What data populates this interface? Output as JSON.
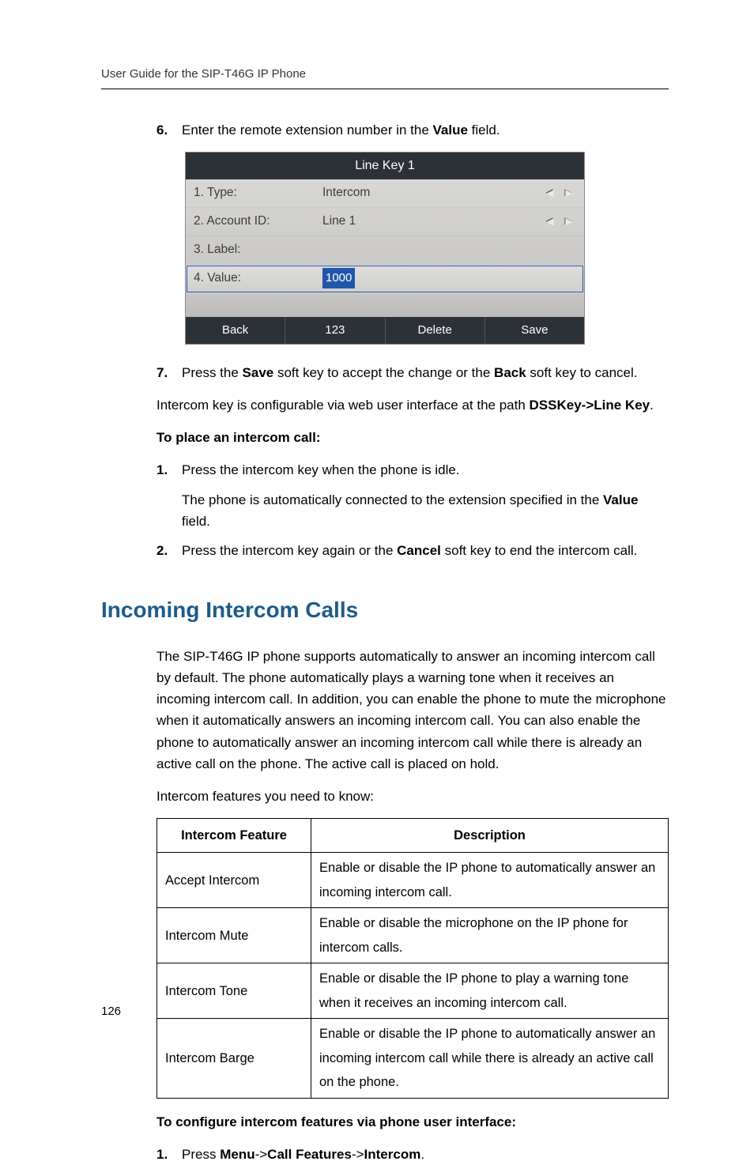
{
  "running_head": "User Guide for the SIP-T46G IP Phone",
  "page_number": "126",
  "steps_a": {
    "s6": {
      "n": "6.",
      "pre": "Enter the remote extension number in the ",
      "bold": "Value",
      "post": " field."
    },
    "s7": {
      "n": "7.",
      "pre": "Press the ",
      "b1": "Save",
      "mid": " soft key to accept the change or the ",
      "b2": "Back",
      "post": " soft key to cancel."
    }
  },
  "phone": {
    "title": "Line Key 1",
    "rows": {
      "r1": {
        "label": "1. Type:",
        "value": "Intercom"
      },
      "r2": {
        "label": "2. Account ID:",
        "value": "Line 1"
      },
      "r3": {
        "label": "3. Label:",
        "value": ""
      },
      "r4": {
        "label": "4. Value:",
        "value": "1000"
      }
    },
    "softkeys": {
      "k1": "Back",
      "k2": "123",
      "k3": "Delete",
      "k4": "Save"
    }
  },
  "config_note": {
    "pre": "Intercom key is configurable via web user interface at the path ",
    "b1": "DSSKey->Line Key",
    "post": "."
  },
  "place_heading": "To place an intercom call:",
  "steps_b": {
    "s1": {
      "n": "1.",
      "text": "Press the intercom key when the phone is idle."
    },
    "s1b": {
      "pre": "The phone is automatically connected to the extension specified in the ",
      "b": "Value",
      "post": " field."
    },
    "s2": {
      "n": "2.",
      "pre": "Press the intercom key again or the ",
      "b": "Cancel",
      "post": " soft key to end the intercom call."
    }
  },
  "h2": "Incoming Intercom Calls",
  "para1": "The SIP-T46G IP phone supports automatically to answer an incoming intercom call by default. The phone automatically plays a warning tone when it receives an incoming intercom call. In addition, you can enable the phone to mute the microphone when it automatically answers an incoming intercom call. You can also enable the phone to automatically answer an incoming intercom call while there is already an active call on the phone. The active call is placed on hold.",
  "para2": "Intercom features you need to know:",
  "table": {
    "head": {
      "c1": "Intercom Feature",
      "c2": "Description"
    },
    "rows": {
      "r1": {
        "f": "Accept Intercom",
        "d": "Enable or disable the IP phone to automatically answer an incoming intercom call."
      },
      "r2": {
        "f": "Intercom Mute",
        "d": "Enable or disable the microphone on the IP phone for intercom calls."
      },
      "r3": {
        "f": "Intercom Tone",
        "d": "Enable or disable the IP phone to play a warning tone when it receives an incoming intercom call."
      },
      "r4": {
        "f": "Intercom Barge",
        "d": "Enable or disable the IP phone to automatically answer an incoming intercom call while there is already an active call on the phone."
      }
    }
  },
  "config_heading": "To configure intercom features via phone user interface:",
  "steps_c": {
    "s1": {
      "n": "1.",
      "pre": "Press ",
      "b1": "Menu",
      "a1": "->",
      "b2": "Call Features",
      "a2": "->",
      "b3": "Intercom",
      "post": "."
    }
  }
}
